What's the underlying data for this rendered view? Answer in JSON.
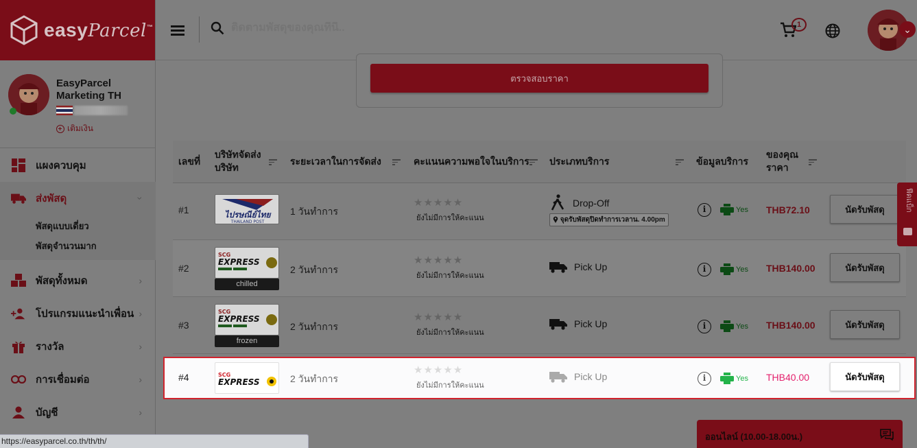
{
  "brand": {
    "name": "easy",
    "name_script": "Parcel",
    "tm": "™"
  },
  "profile": {
    "name": "EasyParcel Marketing TH",
    "topup_label": "เติมเงิน"
  },
  "nav": {
    "dashboard": "แผงควบคุม",
    "send_parcel": "ส่งพัสดุ",
    "sub_single": "พัสดุแบบเดี่ยว",
    "sub_bulk": "พัสดุจำนวนมาก",
    "all_parcels": "พัสดุทั้งหมด",
    "referral": "โปรแกรมแนะนำเพื่อน",
    "rewards": "รางวัล",
    "integrations": "การเชื่อมต่อ",
    "account": "บัญชี"
  },
  "topbar": {
    "search_placeholder": "ติดตามพัสดุของคุณที่นี่..",
    "cart_count": "1"
  },
  "check_button": "ตรวจสอบราคา",
  "table": {
    "headers": {
      "no": "เลขที่",
      "courier": "บริษัทจัดส่ง บริษัท",
      "time": "ระยะเวลาในการจัดส่ง",
      "rating": "คะแนนความพอใจในบริการ",
      "service": "ประเภทบริการ",
      "info": "ข้อมูลบริการ",
      "price": "ของคุณ ราคา"
    },
    "rows": [
      {
        "no": "#1",
        "courier": "Thailand Post",
        "logo_text": "ไปรษณีย์ไทย",
        "logo_sub": "THAILAND POST",
        "tag": "",
        "time": "1 วันทำการ",
        "stars": "★★★★★",
        "rating_note": "ยังไม่มีการให้คะแนน",
        "service": "Drop-Off",
        "service_note": "จุดรับพัสดุปิดทำการเวลาน. 4.00pm",
        "yes": "Yes",
        "price": "THB72.10",
        "action": "นัดรับพัสดุ"
      },
      {
        "no": "#2",
        "courier": "SCG Express",
        "logo_text": "EXPRESS",
        "logo_sub": "SCG",
        "tag": "chilled",
        "time": "2 วันทำการ",
        "stars": "★★★★★",
        "rating_note": "ยังไม่มีการให้คะแนน",
        "service": "Pick Up",
        "service_note": "",
        "yes": "Yes",
        "price": "THB140.00",
        "action": "นัดรับพัสดุ"
      },
      {
        "no": "#3",
        "courier": "SCG Express",
        "logo_text": "EXPRESS",
        "logo_sub": "SCG",
        "tag": "frozen",
        "time": "2 วันทำการ",
        "stars": "★★★★★",
        "rating_note": "ยังไม่มีการให้คะแนน",
        "service": "Pick Up",
        "service_note": "",
        "yes": "Yes",
        "price": "THB140.00",
        "action": "นัดรับพัสดุ"
      },
      {
        "no": "#4",
        "courier": "SCG Express",
        "logo_text": "EXPRESS",
        "logo_sub": "SCG",
        "tag": "",
        "time": "2 วันทำการ",
        "stars": "★★★★★",
        "rating_note": "ยังไม่มีการให้คะแนน",
        "service": "Pick Up",
        "service_note": "",
        "yes": "Yes",
        "price": "THB40.00",
        "action": "นัดรับพัสดุ"
      }
    ]
  },
  "feedback_tab": "ฟีดแบ็ก",
  "chat": {
    "label": "ออนไลน์ (10.00-18.00น.)"
  },
  "status_url": "https://easyparcel.co.th/th/th/",
  "colors": {
    "brand_red": "#c8102e",
    "price_pink": "#e4206c",
    "highlight_border": "#d0222c",
    "yes_green": "#23b34a"
  }
}
